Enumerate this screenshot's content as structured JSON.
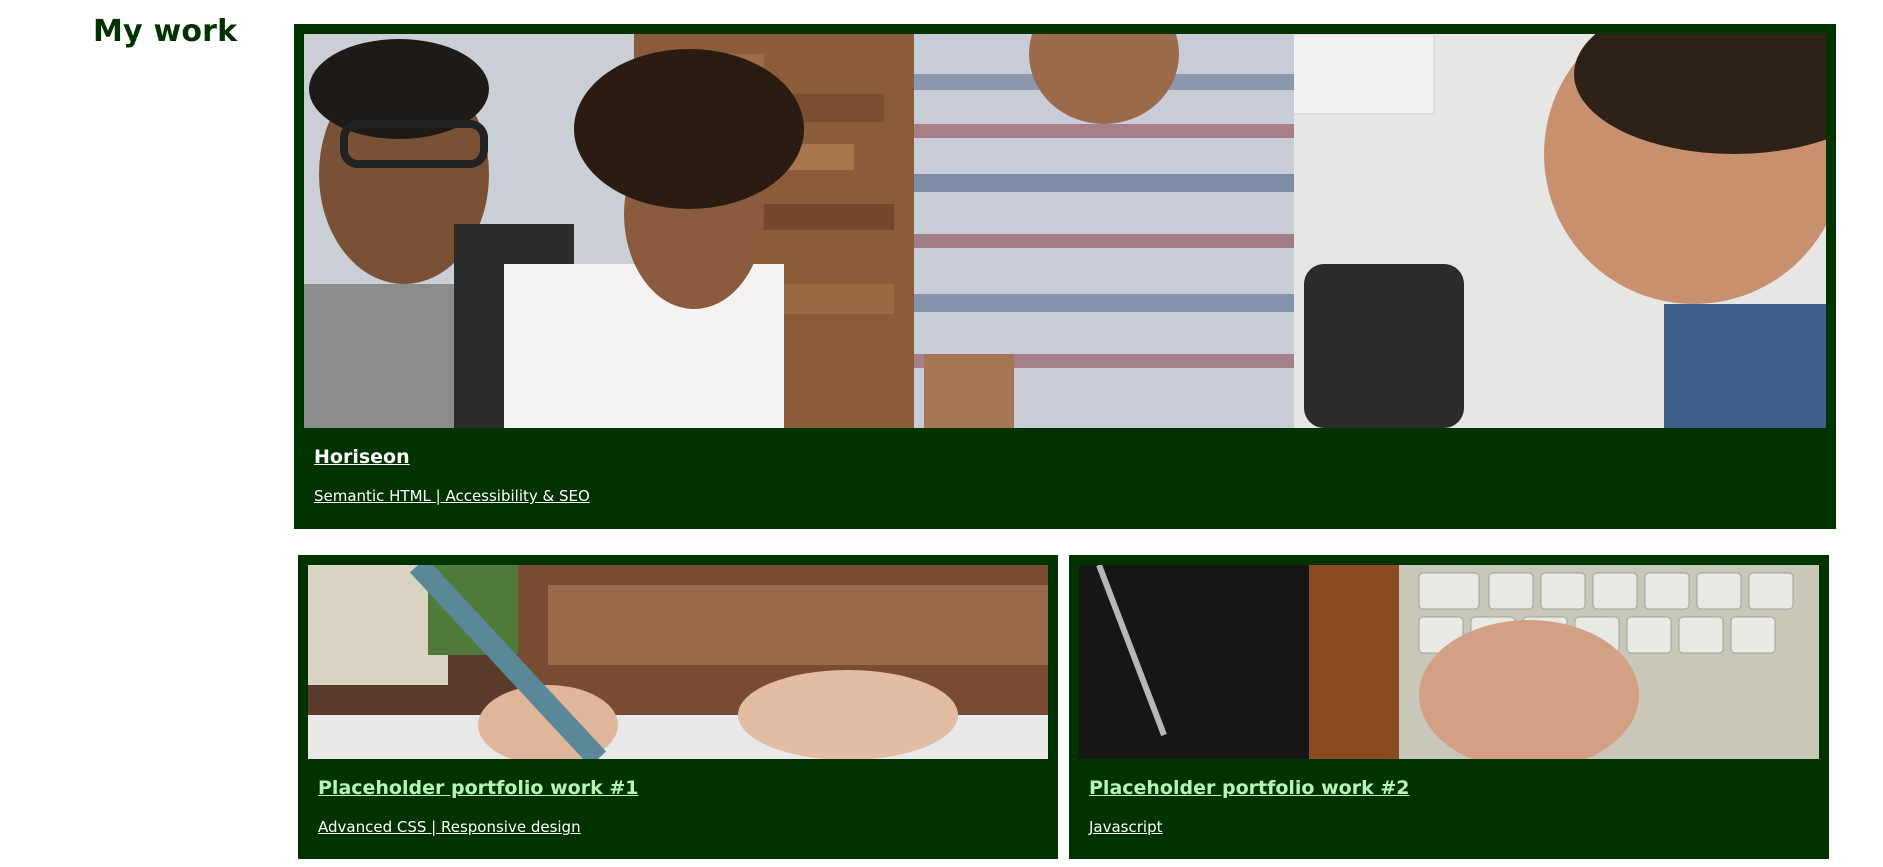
{
  "section": {
    "title": "My work"
  },
  "featured": {
    "title": "Horiseon",
    "tags": "Semantic HTML | Accessibility & SEO",
    "image_icon": "team-meeting-photo"
  },
  "works": [
    {
      "title": "Placeholder portfolio work #1",
      "tags": "Advanced CSS | Responsive design",
      "image_icon": "writing-with-pen-photo"
    },
    {
      "title": "Placeholder portfolio work #2",
      "tags": "Javascript",
      "image_icon": "typing-on-keyboard-photo"
    }
  ],
  "colors": {
    "card_background": "#003300",
    "title_color": "#003300",
    "link_white": "#ffffff",
    "link_green": "#b5f5b5"
  }
}
